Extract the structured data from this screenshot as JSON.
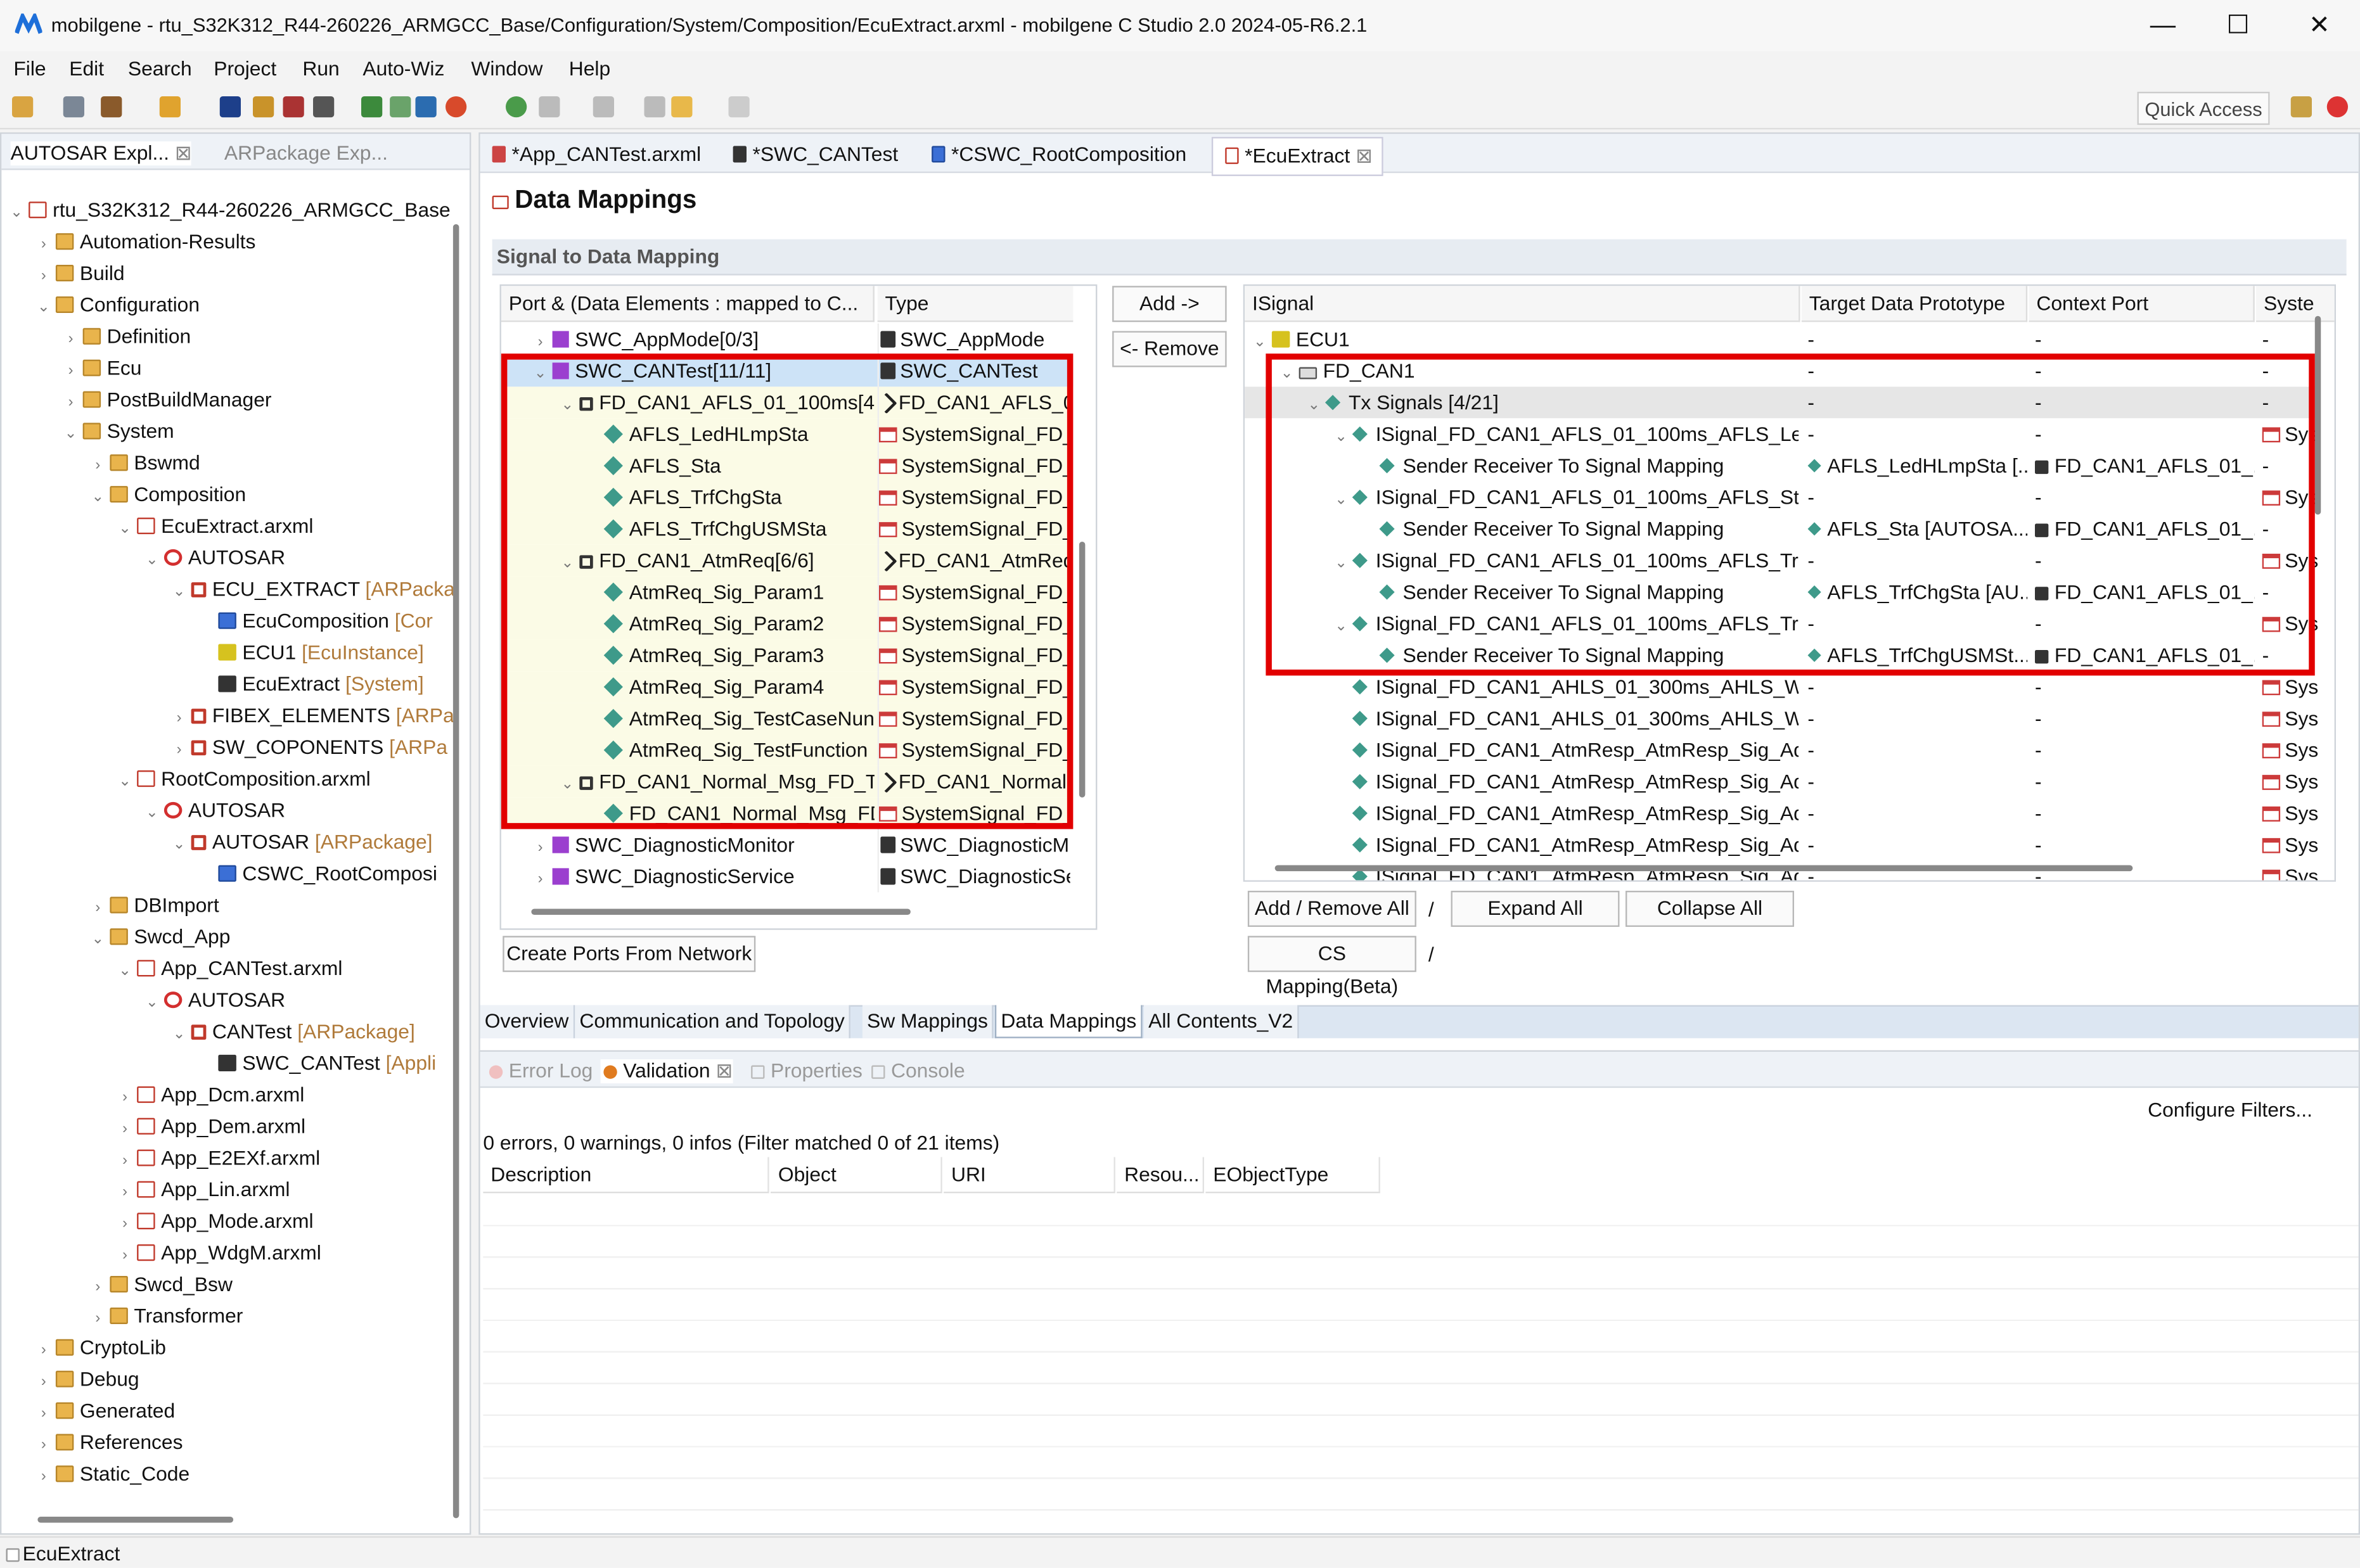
{
  "window": {
    "title": "mobilgene - rtu_S32K312_R44-260226_ARMGCC_Base/Configuration/System/Composition/EcuExtract.arxml - mobilgene C Studio 2.0 2024-05-R6.2.1",
    "minimize": "—",
    "maximize": "☐",
    "close": "✕"
  },
  "menu": [
    "File",
    "Edit",
    "Search",
    "Project",
    "Run",
    "Auto-Wiz",
    "Window",
    "Help"
  ],
  "quick_access": "Quick Access",
  "explorer": {
    "tabs": [
      "AUTOSAR Expl...",
      "ARPackage Exp..."
    ],
    "rows": [
      {
        "t": "rtu_S32K312_R44-260226_ARMGCC_Base",
        "d": 0,
        "ic": "proj",
        "a": "v"
      },
      {
        "t": "Automation-Results",
        "d": 1,
        "ic": "fold",
        "a": ">"
      },
      {
        "t": "Build",
        "d": 1,
        "ic": "fold",
        "a": ">"
      },
      {
        "t": "Configuration",
        "d": 1,
        "ic": "fold",
        "a": "v"
      },
      {
        "t": "Definition",
        "d": 2,
        "ic": "fold",
        "a": ">"
      },
      {
        "t": "Ecu",
        "d": 2,
        "ic": "fold",
        "a": ">"
      },
      {
        "t": "PostBuildManager",
        "d": 2,
        "ic": "fold",
        "a": ">"
      },
      {
        "t": "System",
        "d": 2,
        "ic": "fold",
        "a": "v"
      },
      {
        "t": "Bswmd",
        "d": 3,
        "ic": "fold",
        "a": ">"
      },
      {
        "t": "Composition",
        "d": 3,
        "ic": "fold",
        "a": "v"
      },
      {
        "t": "EcuExtract.arxml",
        "d": 4,
        "ic": "file",
        "a": "v"
      },
      {
        "t": "AUTOSAR",
        "d": 5,
        "ic": "auto",
        "a": "v"
      },
      {
        "t": "ECU_EXTRACT",
        "g": " [ARPacka",
        "d": 6,
        "ic": "pkg",
        "a": "v"
      },
      {
        "t": "EcuComposition",
        "g": " [Cor",
        "d": 7,
        "ic": "cmp",
        "a": ""
      },
      {
        "t": "ECU1",
        "g": " [EcuInstance]",
        "d": 7,
        "ic": "ecu",
        "a": ""
      },
      {
        "t": "EcuExtract",
        "g": " [System]",
        "d": 7,
        "ic": "sysic",
        "a": ""
      },
      {
        "t": "FIBEX_ELEMENTS",
        "g": " [ARPa",
        "d": 6,
        "ic": "pkg",
        "a": ">"
      },
      {
        "t": "SW_COPONENTS",
        "g": " [ARPa",
        "d": 6,
        "ic": "pkg",
        "a": ">"
      },
      {
        "t": "RootComposition.arxml",
        "d": 4,
        "ic": "file",
        "a": "v"
      },
      {
        "t": "AUTOSAR",
        "d": 5,
        "ic": "auto",
        "a": "v"
      },
      {
        "t": "AUTOSAR",
        "g": " [ARPackage]",
        "d": 6,
        "ic": "pkg",
        "a": "v"
      },
      {
        "t": "CSWC_RootComposi",
        "d": 7,
        "ic": "cmp",
        "a": ""
      },
      {
        "t": "DBImport",
        "d": 3,
        "ic": "fold",
        "a": ">"
      },
      {
        "t": "Swcd_App",
        "d": 3,
        "ic": "fold",
        "a": "v"
      },
      {
        "t": "App_CANTest.arxml",
        "d": 4,
        "ic": "file",
        "a": "v"
      },
      {
        "t": "AUTOSAR",
        "d": 5,
        "ic": "auto",
        "a": "v"
      },
      {
        "t": "CANTest",
        "g": " [ARPackage]",
        "d": 6,
        "ic": "pkg",
        "a": "v"
      },
      {
        "t": "SWC_CANTest",
        "g": " [Appli",
        "d": 7,
        "ic": "sysic",
        "a": ""
      },
      {
        "t": "App_Dcm.arxml",
        "d": 4,
        "ic": "file",
        "a": ">"
      },
      {
        "t": "App_Dem.arxml",
        "d": 4,
        "ic": "file",
        "a": ">"
      },
      {
        "t": "App_E2EXf.arxml",
        "d": 4,
        "ic": "file",
        "a": ">"
      },
      {
        "t": "App_Lin.arxml",
        "d": 4,
        "ic": "file",
        "a": ">"
      },
      {
        "t": "App_Mode.arxml",
        "d": 4,
        "ic": "file",
        "a": ">"
      },
      {
        "t": "App_WdgM.arxml",
        "d": 4,
        "ic": "file",
        "a": ">"
      },
      {
        "t": "Swcd_Bsw",
        "d": 3,
        "ic": "fold",
        "a": ">"
      },
      {
        "t": "Transformer",
        "d": 3,
        "ic": "fold",
        "a": ">"
      },
      {
        "t": "CryptoLib",
        "d": 1,
        "ic": "fold",
        "a": ">"
      },
      {
        "t": "Debug",
        "d": 1,
        "ic": "fold",
        "a": ">"
      },
      {
        "t": "Generated",
        "d": 1,
        "ic": "fold",
        "a": ">"
      },
      {
        "t": "References",
        "d": 1,
        "ic": "fold",
        "a": ">"
      },
      {
        "t": "Static_Code",
        "d": 1,
        "ic": "fold",
        "a": ">"
      }
    ]
  },
  "editor_tabs": [
    "*App_CANTest.arxml",
    "*SWC_CANTest",
    "*CSWC_RootComposition",
    "*EcuExtract"
  ],
  "page_title": "Data Mappings",
  "section_title": "Signal to Data Mapping",
  "left_table": {
    "headers": [
      "Port & (Data Elements : mapped to C...",
      "Type"
    ],
    "rows": [
      {
        "a": ">",
        "d": 0,
        "ic": "prt",
        "n": "SWC_AppMode[0/3]",
        "t": "SWC_AppMode",
        "ti": "sysic"
      },
      {
        "a": "v",
        "d": 0,
        "ic": "prt",
        "n": "SWC_CANTest[11/11]",
        "t": "SWC_CANTest",
        "ti": "sysic",
        "sel": true
      },
      {
        "a": "v",
        "d": 1,
        "ic": "box",
        "n": "FD_CAN1_AFLS_01_100ms[4/",
        "t": "FD_CAN1_AFLS_0",
        "ti": "link",
        "y": true
      },
      {
        "a": "",
        "d": 2,
        "ic": "dia",
        "n": "AFLS_LedHLmpSta",
        "t": "SystemSignal_FD_",
        "ti": "sig",
        "y": true
      },
      {
        "a": "",
        "d": 2,
        "ic": "dia",
        "n": "AFLS_Sta",
        "t": "SystemSignal_FD_",
        "ti": "sig",
        "y": true
      },
      {
        "a": "",
        "d": 2,
        "ic": "dia",
        "n": "AFLS_TrfChgSta",
        "t": "SystemSignal_FD_",
        "ti": "sig",
        "y": true
      },
      {
        "a": "",
        "d": 2,
        "ic": "dia",
        "n": "AFLS_TrfChgUSMSta",
        "t": "SystemSignal_FD_",
        "ti": "sig",
        "y": true
      },
      {
        "a": "v",
        "d": 1,
        "ic": "box",
        "n": "FD_CAN1_AtmReq[6/6]",
        "t": "FD_CAN1_AtmReq",
        "ti": "link",
        "y": true
      },
      {
        "a": "",
        "d": 2,
        "ic": "dia",
        "n": "AtmReq_Sig_Param1",
        "t": "SystemSignal_FD_",
        "ti": "sig",
        "y": true
      },
      {
        "a": "",
        "d": 2,
        "ic": "dia",
        "n": "AtmReq_Sig_Param2",
        "t": "SystemSignal_FD_",
        "ti": "sig",
        "y": true
      },
      {
        "a": "",
        "d": 2,
        "ic": "dia",
        "n": "AtmReq_Sig_Param3",
        "t": "SystemSignal_FD_",
        "ti": "sig",
        "y": true
      },
      {
        "a": "",
        "d": 2,
        "ic": "dia",
        "n": "AtmReq_Sig_Param4",
        "t": "SystemSignal_FD_",
        "ti": "sig",
        "y": true
      },
      {
        "a": "",
        "d": 2,
        "ic": "dia",
        "n": "AtmReq_Sig_TestCaseNun",
        "t": "SystemSignal_FD_",
        "ti": "sig",
        "y": true
      },
      {
        "a": "",
        "d": 2,
        "ic": "dia",
        "n": "AtmReq_Sig_TestFunction",
        "t": "SystemSignal_FD_",
        "ti": "sig",
        "y": true
      },
      {
        "a": "v",
        "d": 1,
        "ic": "box",
        "n": "FD_CAN1_Normal_Msg_FD_T",
        "t": "FD_CAN1_Normal",
        "ti": "link",
        "y": true
      },
      {
        "a": "",
        "d": 2,
        "ic": "dia",
        "n": "FD_CAN1_Normal_Msg_FD",
        "t": "SystemSignal_FD_",
        "ti": "sig",
        "y": true
      },
      {
        "a": ">",
        "d": 0,
        "ic": "prt",
        "n": "SWC_DiagnosticMonitor",
        "t": "SWC_DiagnosticM",
        "ti": "sysic"
      },
      {
        "a": ">",
        "d": 0,
        "ic": "prt",
        "n": "SWC_DiagnosticService",
        "t": "SWC_DiagnosticSe",
        "ti": "sysic"
      }
    ]
  },
  "add_button": "Add ->",
  "remove_button": "<- Remove",
  "right_table": {
    "headers": [
      "ISignal",
      "Target Data Prototype",
      "Context Port",
      "Syste"
    ],
    "rows": [
      {
        "a": "v",
        "d": 0,
        "ic": "ecu",
        "n": "ECU1",
        "c1": "-",
        "c2": "-",
        "c3": "-"
      },
      {
        "a": "v",
        "d": 1,
        "ic": "can",
        "n": "FD_CAN1",
        "c1": "-",
        "c2": "-",
        "c3": "-"
      },
      {
        "a": "v",
        "d": 2,
        "ic": "dia",
        "n": "Tx Signals [4/21]",
        "c1": "-",
        "c2": "-",
        "c3": "-",
        "sel": true
      },
      {
        "a": "v",
        "d": 3,
        "ic": "dia",
        "n": "ISignal_FD_CAN1_AFLS_01_100ms_AFLS_LedH",
        "c1": "-",
        "c2": "-",
        "c3": "Sys"
      },
      {
        "a": "",
        "d": 4,
        "ic": "dia",
        "n": "Sender Receiver To Signal Mapping",
        "c1": "AFLS_LedHLmpSta [...",
        "c2": "FD_CAN1_AFLS_01_...",
        "c3": "-"
      },
      {
        "a": "v",
        "d": 3,
        "ic": "dia",
        "n": "ISignal_FD_CAN1_AFLS_01_100ms_AFLS_Sta",
        "c1": "-",
        "c2": "-",
        "c3": "Sys"
      },
      {
        "a": "",
        "d": 4,
        "ic": "dia",
        "n": "Sender Receiver To Signal Mapping",
        "c1": "AFLS_Sta [AUTOSA...",
        "c2": "FD_CAN1_AFLS_01_...",
        "c3": "-"
      },
      {
        "a": "v",
        "d": 3,
        "ic": "dia",
        "n": "ISignal_FD_CAN1_AFLS_01_100ms_AFLS_TrfCh",
        "c1": "-",
        "c2": "-",
        "c3": "Sys"
      },
      {
        "a": "",
        "d": 4,
        "ic": "dia",
        "n": "Sender Receiver To Signal Mapping",
        "c1": "AFLS_TrfChgSta [AU...",
        "c2": "FD_CAN1_AFLS_01_...",
        "c3": "-"
      },
      {
        "a": "v",
        "d": 3,
        "ic": "dia",
        "n": "ISignal_FD_CAN1_AFLS_01_100ms_AFLS_TrfCh",
        "c1": "-",
        "c2": "-",
        "c3": "Sys"
      },
      {
        "a": "",
        "d": 4,
        "ic": "dia",
        "n": "Sender Receiver To Signal Mapping",
        "c1": "AFLS_TrfChgUSMSt...",
        "c2": "FD_CAN1_AFLS_01_...",
        "c3": "-"
      },
      {
        "a": "",
        "d": 3,
        "ic": "dia",
        "n": "ISignal_FD_CAN1_AHLS_01_300ms_AHLS_Wrn",
        "c1": "-",
        "c2": "-",
        "c3": "Sys"
      },
      {
        "a": "",
        "d": 3,
        "ic": "dia",
        "n": "ISignal_FD_CAN1_AHLS_01_300ms_AHLS_Wrn",
        "c1": "-",
        "c2": "-",
        "c3": "Sys"
      },
      {
        "a": "",
        "d": 3,
        "ic": "dia",
        "n": "ISignal_FD_CAN1_AtmResp_AtmResp_Sig_Adc",
        "c1": "-",
        "c2": "-",
        "c3": "Sys"
      },
      {
        "a": "",
        "d": 3,
        "ic": "dia",
        "n": "ISignal_FD_CAN1_AtmResp_AtmResp_Sig_Adc",
        "c1": "-",
        "c2": "-",
        "c3": "Sys"
      },
      {
        "a": "",
        "d": 3,
        "ic": "dia",
        "n": "ISignal_FD_CAN1_AtmResp_AtmResp_Sig_Adc",
        "c1": "-",
        "c2": "-",
        "c3": "Sys"
      },
      {
        "a": "",
        "d": 3,
        "ic": "dia",
        "n": "ISignal_FD_CAN1_AtmResp_AtmResp_Sig_Adc",
        "c1": "-",
        "c2": "-",
        "c3": "Sys"
      },
      {
        "a": "",
        "d": 3,
        "ic": "dia",
        "n": "ISignal_FD_CAN1_AtmResp_AtmResp_Sig_Adc",
        "c1": "-",
        "c2": "-",
        "c3": "Sys"
      }
    ]
  },
  "buttons": {
    "add_remove_all": "Add / Remove All",
    "sep": "/",
    "expand_all": "Expand All",
    "collapse_all": "Collapse All",
    "create_ports": "Create Ports From Network",
    "cs_mapping": "CS Mapping(Beta)"
  },
  "page_tabs": [
    "Overview",
    "Communication and Topology",
    "Sw Mappings",
    "Data Mappings",
    "All Contents_V2"
  ],
  "bottom_tabs": [
    "Error Log",
    "Validation",
    "Properties",
    "Console"
  ],
  "validation": {
    "summary": "0 errors, 0 warnings, 0 infos (Filter matched 0 of 21 items)",
    "configure": "Configure Filters...",
    "headers": [
      "Description",
      "Object",
      "URI",
      "Resou...",
      "EObjectType"
    ]
  },
  "status": "EcuExtract"
}
